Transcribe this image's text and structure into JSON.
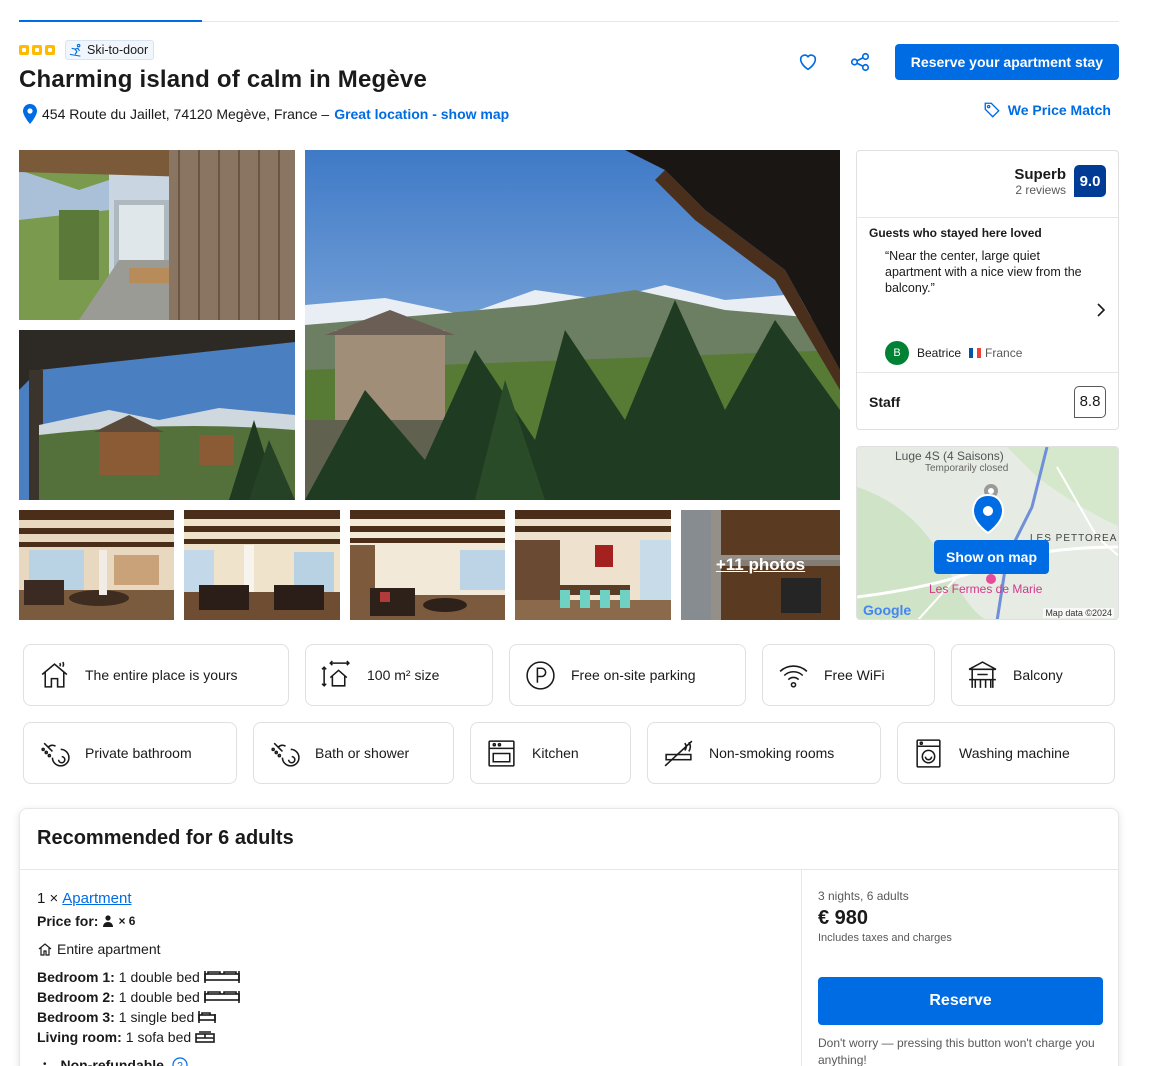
{
  "header": {
    "stars": 3,
    "badge": "Ski-to-door",
    "title": "Charming island of calm in Megève",
    "address": "454 Route du Jaillet, 74120 Megève, France –",
    "location_link": "Great location - show map",
    "reserve_button": "Reserve your apartment stay",
    "price_match": "We Price Match"
  },
  "gallery": {
    "more_photos": "+11 photos"
  },
  "review": {
    "rating_word": "Superb",
    "review_count": "2 reviews",
    "score": "9.0",
    "loved_heading": "Guests who stayed here loved",
    "quote": "“Near the center, large quiet apartment with a nice view from the balcony.”",
    "author_initial": "B",
    "author_name": "Beatrice",
    "author_country": "France",
    "staff_label": "Staff",
    "staff_score": "8.8"
  },
  "map": {
    "poi_1": "Luge 4S (4 Saisons)",
    "poi_1_status": "Temporarily closed",
    "area": "LES PETTOREA",
    "poi_2": "Les Fermes de Marie",
    "button": "Show on map",
    "brand": "Google",
    "copyright": "Map data ©2024"
  },
  "facilities": [
    {
      "label": "The entire place is yours",
      "icon": "house-icon"
    },
    {
      "label": "100 m² size",
      "icon": "size-icon"
    },
    {
      "label": "Free on-site parking",
      "icon": "parking-icon"
    },
    {
      "label": "Free WiFi",
      "icon": "wifi-icon"
    },
    {
      "label": "Balcony",
      "icon": "balcony-icon"
    },
    {
      "label": "Private bathroom",
      "icon": "shower-icon"
    },
    {
      "label": "Bath or shower",
      "icon": "shower-icon"
    },
    {
      "label": "Kitchen",
      "icon": "kitchen-icon"
    },
    {
      "label": "Non-smoking rooms",
      "icon": "no-smoking-icon"
    },
    {
      "label": "Washing machine",
      "icon": "washing-machine-icon"
    }
  ],
  "recommended": {
    "heading": "Recommended for 6 adults",
    "qty": "1 ×",
    "unit": "Apartment",
    "price_for_label": "Price for:",
    "price_for_count": "× 6",
    "entire": "Entire apartment",
    "beds": [
      {
        "room": "Bedroom 1:",
        "bed": "1 double bed",
        "type": "double"
      },
      {
        "room": "Bedroom 2:",
        "bed": "1 double bed",
        "type": "double"
      },
      {
        "room": "Bedroom 3:",
        "bed": "1 single bed",
        "type": "single"
      },
      {
        "room": "Living room:",
        "bed": "1 sofa bed",
        "type": "sofa"
      }
    ],
    "policy": "Non-refundable",
    "stay": "3 nights, 6 adults",
    "price": "€ 980",
    "taxes": "Includes taxes and charges",
    "reserve": "Reserve",
    "note": "Don't worry — pressing this button won't charge you anything!"
  },
  "colors": {
    "primary": "#006ce4",
    "score_bg": "#003b95",
    "star": "#febb02",
    "avatar": "#008234"
  }
}
